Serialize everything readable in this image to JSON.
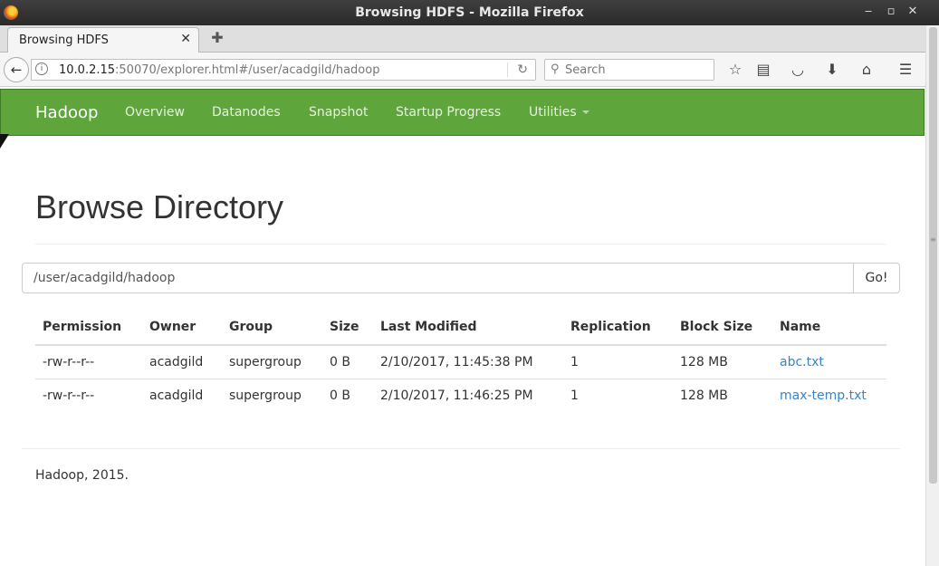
{
  "window": {
    "title": "Browsing HDFS - Mozilla Firefox"
  },
  "tab": {
    "label": "Browsing HDFS"
  },
  "address": {
    "host": "10.0.2.15",
    "rest": ":50070/explorer.html#/user/acadgild/hadoop"
  },
  "search": {
    "placeholder": "Search"
  },
  "nav": {
    "brand": "Hadoop",
    "items": [
      "Overview",
      "Datanodes",
      "Snapshot",
      "Startup Progress",
      "Utilities"
    ]
  },
  "page": {
    "title": "Browse Directory",
    "path_value": "/user/acadgild/hadoop",
    "go_label": "Go!"
  },
  "table": {
    "headers": [
      "Permission",
      "Owner",
      "Group",
      "Size",
      "Last Modified",
      "Replication",
      "Block Size",
      "Name"
    ],
    "rows": [
      [
        "-rw-r--r--",
        "acadgild",
        "supergroup",
        "0 B",
        "2/10/2017, 11:45:38 PM",
        "1",
        "128 MB",
        "abc.txt"
      ],
      [
        "-rw-r--r--",
        "acadgild",
        "supergroup",
        "0 B",
        "2/10/2017, 11:46:25 PM",
        "1",
        "128 MB",
        "max-temp.txt"
      ]
    ]
  },
  "footer": {
    "text": "Hadoop, 2015."
  },
  "colors": {
    "navbar": "#5ea53c",
    "link": "#3a83c4"
  }
}
